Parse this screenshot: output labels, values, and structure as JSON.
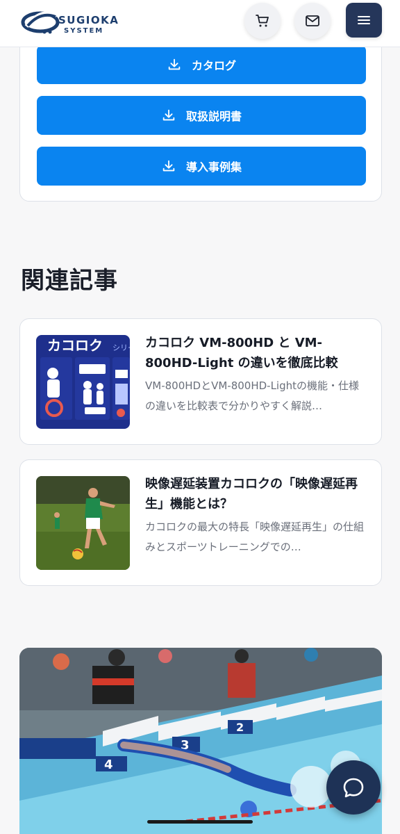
{
  "header": {
    "logo_line1": "SUGIOKA",
    "logo_line2": "SYSTEM",
    "brand_color": "#1d3e6e",
    "icons": [
      "cart-icon",
      "mail-icon",
      "menu-icon"
    ]
  },
  "downloads": {
    "accent": "#0a84f0",
    "buttons": [
      {
        "label": "カタログ",
        "icon": "download-icon"
      },
      {
        "label": "取扱説明書",
        "icon": "download-icon"
      },
      {
        "label": "導入事例集",
        "icon": "download-icon"
      }
    ]
  },
  "related": {
    "heading": "関連記事",
    "articles": [
      {
        "title": "カコロク VM-800HD と VM-800HD-Light の違いを徹底比較",
        "desc": "VM-800HDとVM-800HD-Lightの機能・仕様の違いを比較表で分かりやすく解説…",
        "thumb_text": "カコロク",
        "thumb_text2": "シリー"
      },
      {
        "title": "映像遅延装置カコロクの「映像遅延再生」機能とは？",
        "desc": "カコロクの最大の特長「映像遅延再生」の仕組みとスポーツトレーニングでの…"
      }
    ]
  },
  "hero": {
    "lane_numbers": [
      "2",
      "3",
      "4"
    ]
  },
  "chat": {
    "icon": "chat-bubble-icon"
  }
}
